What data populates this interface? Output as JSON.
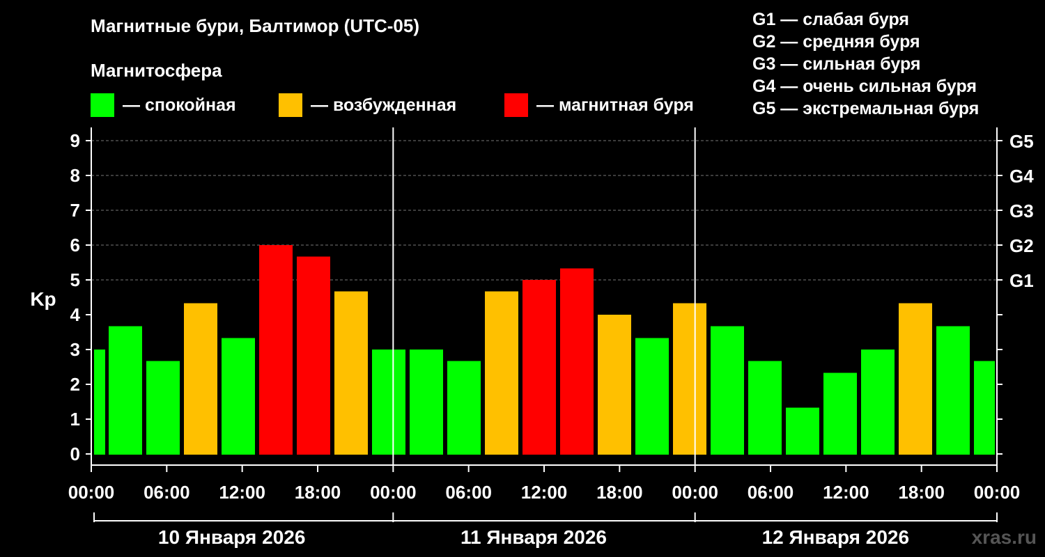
{
  "header": {
    "title": "Магнитные бури, Балтимор (UTC-05)",
    "subtitle": "Магнитосфера"
  },
  "legend": {
    "items": [
      {
        "label": "— спокойная",
        "color": "#00ff00"
      },
      {
        "label": "— возбужденная",
        "color": "#ffc000"
      },
      {
        "label": "— магнитная буря",
        "color": "#ff0000"
      }
    ],
    "storm_levels": [
      "G1 — слабая буря",
      "G2 — средняя буря",
      "G3 — сильная буря",
      "G4 — очень сильная буря",
      "G5 — экстремальная буря"
    ]
  },
  "chart_data": {
    "type": "bar",
    "ylabel": "Kp",
    "ylim": [
      0,
      9
    ],
    "yticks": [
      "0",
      "1",
      "2",
      "3",
      "4",
      "5",
      "6",
      "7",
      "8",
      "9"
    ],
    "right_ticks": [
      {
        "value": 5,
        "label": "G1"
      },
      {
        "value": 6,
        "label": "G2"
      },
      {
        "value": 7,
        "label": "G3"
      },
      {
        "value": 8,
        "label": "G4"
      },
      {
        "value": 9,
        "label": "G5"
      }
    ],
    "xtick_labels": [
      "00:00",
      "06:00",
      "12:00",
      "18:00",
      "00:00",
      "06:00",
      "12:00",
      "18:00",
      "00:00",
      "06:00",
      "12:00",
      "18:00",
      "00:00"
    ],
    "days": [
      "10 Января 2026",
      "11 Января 2026",
      "12 Января 2026"
    ],
    "values": [
      3.0,
      3.67,
      2.67,
      4.33,
      3.33,
      6.0,
      5.67,
      4.67,
      3.0,
      3.0,
      2.67,
      4.67,
      5.0,
      5.33,
      4.0,
      3.33,
      4.33,
      3.67,
      2.67,
      1.33,
      2.33,
      3.0,
      4.33,
      3.67,
      2.67
    ],
    "levels": [
      "quiet",
      "quiet",
      "quiet",
      "active",
      "quiet",
      "storm",
      "storm",
      "active",
      "quiet",
      "quiet",
      "quiet",
      "active",
      "storm",
      "storm",
      "active",
      "quiet",
      "active",
      "quiet",
      "quiet",
      "quiet",
      "quiet",
      "quiet",
      "active",
      "quiet",
      "quiet"
    ],
    "colors": {
      "quiet": "#00ff00",
      "active": "#ffc000",
      "storm": "#ff0000"
    },
    "grid": true
  },
  "watermark": "xras.ru"
}
